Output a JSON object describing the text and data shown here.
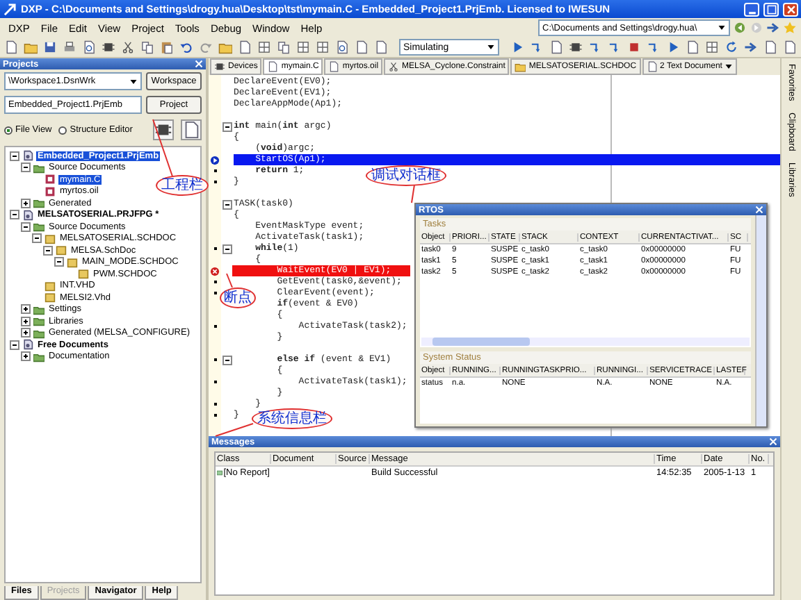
{
  "window": {
    "title": "DXP - C:\\Documents and Settings\\drogy.hua\\Desktop\\tst\\mymain.C - Embedded_Project1.PrjEmb. Licensed to IWESUN"
  },
  "menu": [
    "DXP",
    "File",
    "Edit",
    "View",
    "Project",
    "Tools",
    "Debug",
    "Window",
    "Help"
  ],
  "path_field": {
    "value": "C:\\Documents and Settings\\drogy.hua\\"
  },
  "toolbar": {
    "mode_select": {
      "value": "Simulating"
    }
  },
  "projects_panel": {
    "title": "Projects",
    "workspace_select": {
      "value": "\\Workspace1.DsnWrk"
    },
    "workspace_button": "Workspace",
    "project_field": {
      "value": "Embedded_Project1.PrjEmb"
    },
    "project_button": "Project",
    "view_options": [
      {
        "label": "File View",
        "selected": true
      },
      {
        "label": "Structure Editor",
        "selected": false
      }
    ],
    "tree": [
      {
        "label": "Embedded_Project1.PrjEmb",
        "kind": "project",
        "expanded": true,
        "selected": true,
        "children": [
          {
            "label": "Source Documents",
            "kind": "folder",
            "expanded": true,
            "selected": false,
            "children": [
              {
                "label": "mymain.C",
                "kind": "file",
                "selected": true
              },
              {
                "label": "myrtos.oil",
                "kind": "file",
                "selected": false
              }
            ]
          },
          {
            "label": "Generated",
            "kind": "folder",
            "expanded": false,
            "selected": false
          }
        ]
      },
      {
        "label": "MELSATOSERIAL.PRJFPG *",
        "kind": "project",
        "expanded": true,
        "selected": false,
        "children": [
          {
            "label": "Source Documents",
            "kind": "folder",
            "expanded": true,
            "selected": false,
            "children": [
              {
                "label": "MELSATOSERIAL.SCHDOC",
                "kind": "sheet",
                "expanded": true,
                "selected": false,
                "children": [
                  {
                    "label": "MELSA.SchDoc",
                    "kind": "sheet",
                    "expanded": true,
                    "selected": false,
                    "children": [
                      {
                        "label": "MAIN_MODE.SCHDOC",
                        "kind": "sheet",
                        "expanded": true,
                        "selected": false,
                        "children": [
                          {
                            "label": "PWM.SCHDOC",
                            "kind": "sheet",
                            "selected": false
                          }
                        ]
                      }
                    ]
                  }
                ]
              },
              {
                "label": "INT.VHD",
                "kind": "sheet",
                "selected": false
              },
              {
                "label": "MELSI2.Vhd",
                "kind": "sheet",
                "selected": false
              }
            ]
          },
          {
            "label": "Settings",
            "kind": "folder",
            "expanded": false,
            "selected": false
          },
          {
            "label": "Libraries",
            "kind": "folder",
            "expanded": false,
            "selected": false
          },
          {
            "label": "Generated (MELSA_CONFIGURE)",
            "kind": "folder",
            "expanded": false,
            "selected": false
          }
        ]
      },
      {
        "label": "Free Documents",
        "kind": "project",
        "expanded": true,
        "selected": false,
        "children": [
          {
            "label": "Documentation",
            "kind": "folder",
            "expanded": false,
            "selected": false
          }
        ]
      }
    ]
  },
  "panel_tabs": [
    {
      "label": "Files",
      "selected": false
    },
    {
      "label": "Projects",
      "selected": true
    },
    {
      "label": "Navigator",
      "selected": false
    },
    {
      "label": "Help",
      "selected": false
    }
  ],
  "document_tabs": [
    {
      "label": "Devices",
      "selected": false
    },
    {
      "label": "mymain.C",
      "selected": true
    },
    {
      "label": "myrtos.oil",
      "selected": false
    },
    {
      "label": "MELSA_Cyclone.Constraint",
      "selected": false
    },
    {
      "label": "MELSATOSERIAL.SCHDOC",
      "selected": false
    },
    {
      "label": "2 Text Document",
      "selected": false,
      "kind": "dropdown"
    }
  ],
  "editor": {
    "lines": [
      {
        "text": "DeclareEvent(EV0);",
        "current": false,
        "breakpoint": false,
        "executable": false,
        "fold": false,
        "space_before": false
      },
      {
        "text": "DeclareEvent(EV1);",
        "current": false,
        "breakpoint": false,
        "executable": false,
        "fold": false,
        "space_before": false
      },
      {
        "text": "DeclareAppMode(Ap1);",
        "current": false,
        "breakpoint": false,
        "executable": false,
        "fold": false,
        "space_before": false
      },
      {
        "text": "**int** main(**int** argc)",
        "current": false,
        "breakpoint": false,
        "executable": false,
        "fold": true,
        "space_before": true
      },
      {
        "text": "{",
        "current": false,
        "breakpoint": false,
        "executable": false,
        "fold": false,
        "space_before": false
      },
      {
        "text": "    (**void**)argc;",
        "current": false,
        "breakpoint": false,
        "executable": false,
        "fold": false,
        "space_before": false
      },
      {
        "text": "    StartOS(Ap1);",
        "current": true,
        "breakpoint": false,
        "executable": false,
        "fold": false,
        "space_before": false
      },
      {
        "text": "    **return** 1;",
        "current": false,
        "breakpoint": false,
        "executable": true,
        "fold": false,
        "space_before": false
      },
      {
        "text": "}",
        "current": false,
        "breakpoint": false,
        "executable": true,
        "fold": false,
        "space_before": false
      },
      {
        "text": "TASK(task0)",
        "current": false,
        "breakpoint": false,
        "executable": false,
        "fold": true,
        "space_before": true
      },
      {
        "text": "{",
        "current": false,
        "breakpoint": false,
        "executable": false,
        "fold": false,
        "space_before": false
      },
      {
        "text": "    EventMaskType event;",
        "current": false,
        "breakpoint": false,
        "executable": false,
        "fold": false,
        "space_before": false
      },
      {
        "text": "    ActivateTask(task1);",
        "current": false,
        "breakpoint": false,
        "executable": false,
        "fold": false,
        "space_before": false
      },
      {
        "text": "    **while**(1)",
        "current": false,
        "breakpoint": false,
        "executable": true,
        "fold": true,
        "space_before": false
      },
      {
        "text": "    {",
        "current": false,
        "breakpoint": false,
        "executable": false,
        "fold": false,
        "space_before": false
      },
      {
        "text": "        WaitEvent(EV0 | EV1);",
        "current": false,
        "breakpoint": true,
        "executable": false,
        "fold": false,
        "space_before": false
      },
      {
        "text": "        GetEvent(task0,&event);",
        "current": false,
        "breakpoint": false,
        "executable": true,
        "fold": false,
        "space_before": false
      },
      {
        "text": "        ClearEvent(event);",
        "current": false,
        "breakpoint": false,
        "executable": true,
        "fold": false,
        "space_before": false
      },
      {
        "text": "        **if**(event & EV0)",
        "current": false,
        "breakpoint": false,
        "executable": false,
        "fold": false,
        "space_before": false
      },
      {
        "text": "        {",
        "current": false,
        "breakpoint": false,
        "executable": false,
        "fold": false,
        "space_before": false
      },
      {
        "text": "            ActivateTask(task2);",
        "current": false,
        "breakpoint": false,
        "executable": true,
        "fold": false,
        "space_before": false
      },
      {
        "text": "        }",
        "current": false,
        "breakpoint": false,
        "executable": false,
        "fold": false,
        "space_before": false
      },
      {
        "text": "        **else if** (event & EV1)",
        "current": false,
        "breakpoint": false,
        "executable": true,
        "fold": true,
        "space_before": true
      },
      {
        "text": "        {",
        "current": false,
        "breakpoint": false,
        "executable": false,
        "fold": false,
        "space_before": false
      },
      {
        "text": "            ActivateTask(task1);",
        "current": false,
        "breakpoint": false,
        "executable": true,
        "fold": false,
        "space_before": false
      },
      {
        "text": "        }",
        "current": false,
        "breakpoint": false,
        "executable": false,
        "fold": false,
        "space_before": false
      },
      {
        "text": "    }",
        "current": false,
        "breakpoint": false,
        "executable": true,
        "fold": false,
        "space_before": false
      },
      {
        "text": "}",
        "current": false,
        "breakpoint": false,
        "executable": true,
        "fold": false,
        "space_before": false
      }
    ]
  },
  "rtos": {
    "title": "RTOS",
    "tasks": {
      "title": "Tasks",
      "columns": [
        "Object",
        "PRIORI...",
        "STATE",
        "STACK",
        "CONTEXT",
        "CURRENTACTIVAT...",
        "SC"
      ],
      "rows": [
        [
          "task0",
          "9",
          "SUSPE",
          "c_task0",
          "c_task0",
          "0x00000000",
          "FU"
        ],
        [
          "task1",
          "5",
          "SUSPE",
          "c_task1",
          "c_task1",
          "0x00000000",
          "FU"
        ],
        [
          "task2",
          "5",
          "SUSPE",
          "c_task2",
          "c_task2",
          "0x00000000",
          "FU"
        ]
      ]
    },
    "system_status": {
      "title": "System Status",
      "columns": [
        "Object",
        "RUNNING...",
        "RUNNINGTASKPRIO...",
        "RUNNINGI...",
        "SERVICETRACE",
        "LASTEF"
      ],
      "rows": [
        [
          "status",
          "n.a.",
          "NONE",
          "N.A.",
          "NONE",
          "N.A."
        ]
      ]
    }
  },
  "messages": {
    "title": "Messages",
    "columns": [
      "Class",
      "Document",
      "Source",
      "Message",
      "Time",
      "Date",
      "No."
    ],
    "rows": [
      [
        "[No Report]",
        "",
        "",
        "Build Successful",
        "14:52:35",
        "2005-1-13",
        "1"
      ]
    ]
  },
  "side_tabs": [
    "Favorites",
    "Clipboard",
    "Libraries"
  ],
  "callouts": [
    "工程栏",
    "调试对话框",
    "断点",
    "系统信息栏"
  ]
}
